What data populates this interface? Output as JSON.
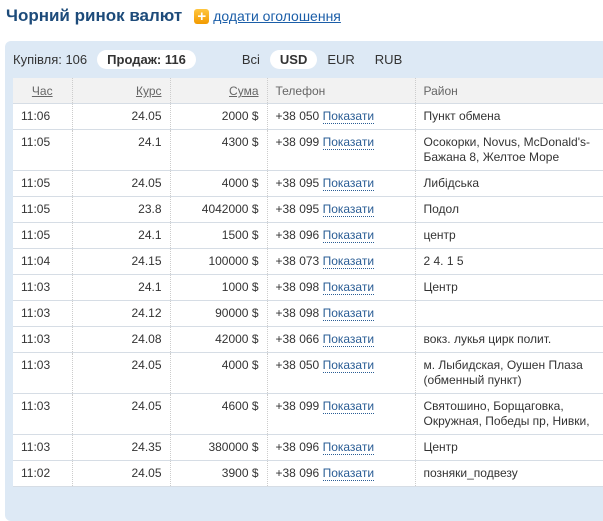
{
  "header": {
    "title": "Чорний ринок валют",
    "add_link": "додати оголошення"
  },
  "filters": {
    "buy": "Купівля: 106",
    "sell": "Продаж: 116",
    "all": "Всі",
    "currencies": [
      "USD",
      "EUR",
      "RUB"
    ]
  },
  "columns": [
    "Час",
    "Курс",
    "Сума",
    "Телефон",
    "Район"
  ],
  "show_label": "Показати",
  "rows": [
    {
      "time": "11:06",
      "rate": "24.05",
      "sum": "2000 $",
      "phone": "+38 050",
      "district": "Пункт обмена"
    },
    {
      "time": "11:05",
      "rate": "24.1",
      "sum": "4300 $",
      "phone": "+38 099",
      "district": "Осокорки, Novus, McDonald's-Бажана 8, Желтое Море"
    },
    {
      "time": "11:05",
      "rate": "24.05",
      "sum": "4000 $",
      "phone": "+38 095",
      "district": "Либідська"
    },
    {
      "time": "11:05",
      "rate": "23.8",
      "sum": "4042000 $",
      "phone": "+38 095",
      "district": "Подол"
    },
    {
      "time": "11:05",
      "rate": "24.1",
      "sum": "1500 $",
      "phone": "+38 096",
      "district": "центр"
    },
    {
      "time": "11:04",
      "rate": "24.15",
      "sum": "100000 $",
      "phone": "+38 073",
      "district": "2 4. 1 5"
    },
    {
      "time": "11:03",
      "rate": "24.1",
      "sum": "1000 $",
      "phone": "+38 098",
      "district": "Центр"
    },
    {
      "time": "11:03",
      "rate": "24.12",
      "sum": "90000 $",
      "phone": "+38 098",
      "district": ""
    },
    {
      "time": "11:03",
      "rate": "24.08",
      "sum": "42000 $",
      "phone": "+38 066",
      "district": "вокз. лукья цирк полит."
    },
    {
      "time": "11:03",
      "rate": "24.05",
      "sum": "4000 $",
      "phone": "+38 050",
      "district": "м. Лыбидская, Оушен Плаза (обменный пункт)"
    },
    {
      "time": "11:03",
      "rate": "24.05",
      "sum": "4600 $",
      "phone": "+38 099",
      "district": "Святошино, Борщаговка, Окружная, Победы пр, Нивки,"
    },
    {
      "time": "11:03",
      "rate": "24.35",
      "sum": "380000 $",
      "phone": "+38 096",
      "district": "Центр"
    },
    {
      "time": "11:02",
      "rate": "24.05",
      "sum": "3900 $",
      "phone": "+38 096",
      "district": "позняки_подвезу"
    }
  ]
}
